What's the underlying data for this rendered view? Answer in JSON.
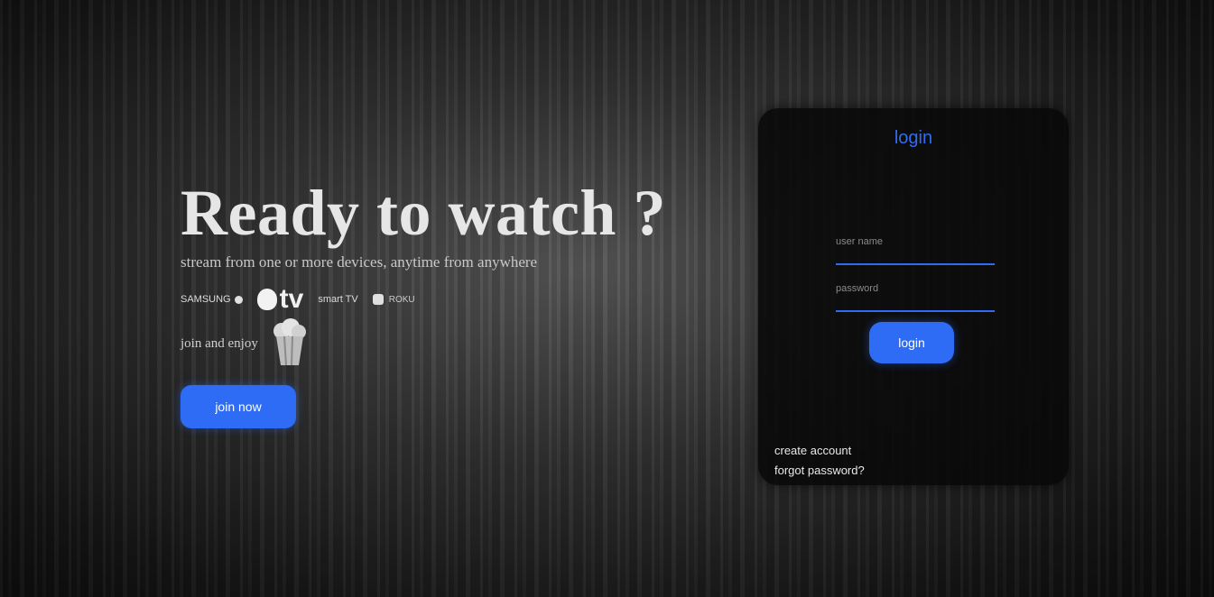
{
  "hero": {
    "title": "Ready to watch ?",
    "subtitle": "stream from one or more devices, anytime from anywhere",
    "devices": [
      {
        "name": "samsung-tv",
        "label": "SAMSUNG"
      },
      {
        "name": "apple-tv",
        "label": "tv"
      },
      {
        "name": "smart-tv",
        "label": "smart TV"
      },
      {
        "name": "roku",
        "label": "ROKU"
      }
    ],
    "enjoy_text": "join and enjoy",
    "join_label": "join now"
  },
  "login": {
    "title": "login",
    "username_label": "user name",
    "username_value": "",
    "password_label": "password",
    "password_value": "",
    "button_label": "login",
    "create_account": "create account",
    "forgot_password": "forgot password?"
  },
  "colors": {
    "accent": "#2f6cf5",
    "card_bg": "#080808",
    "text_light": "#e6e6e6"
  },
  "icons": [
    "apple-icon",
    "popcorn-icon",
    "roku-icon"
  ]
}
